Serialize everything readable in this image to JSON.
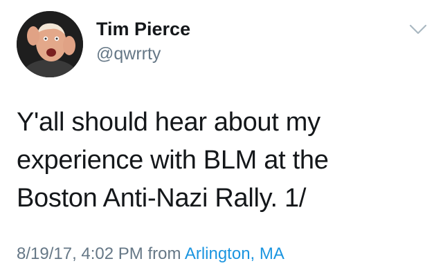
{
  "author": {
    "display_name": "Tim Pierce",
    "handle": "@qwrrty"
  },
  "tweet": {
    "text": "Y'all should hear about my\nexperience with BLM at the\nBoston Anti-Nazi Rally. 1/",
    "timestamp": "8/19/17, 4:02 PM",
    "from_label": "from",
    "location": "Arlington, MA"
  },
  "icons": {
    "menu": "chevron-down-icon"
  },
  "colors": {
    "text": "#14171a",
    "secondary": "#657786",
    "link": "#1b95e0",
    "chevron": "#aab8c2"
  }
}
